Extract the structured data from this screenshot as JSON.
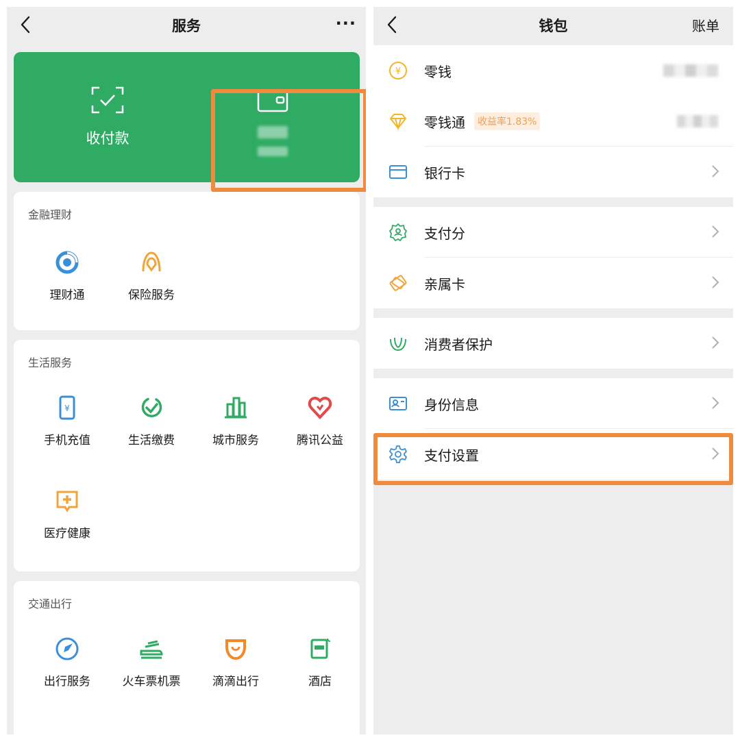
{
  "left": {
    "nav": {
      "title": "服务",
      "more": "···"
    },
    "card": {
      "pay_label": "收付款",
      "wallet_label": ""
    },
    "sections": [
      {
        "title": "金融理财",
        "items": [
          "理财通",
          "保险服务"
        ]
      },
      {
        "title": "生活服务",
        "items": [
          "手机充值",
          "生活缴费",
          "城市服务",
          "腾讯公益",
          "医疗健康"
        ]
      },
      {
        "title": "交通出行",
        "items": [
          "出行服务",
          "火车票机票",
          "滴滴出行",
          "酒店"
        ]
      }
    ]
  },
  "right": {
    "nav": {
      "title": "钱包",
      "bill": "账单"
    },
    "rows": {
      "change": "零钱",
      "licaitong": "零钱通",
      "yield_badge": "收益率1.83%",
      "bank_card": "银行卡",
      "pay_score": "支付分",
      "family_card": "亲属卡",
      "consumer_protection": "消费者保护",
      "identity": "身份信息",
      "pay_settings": "支付设置"
    }
  },
  "colors": {
    "wechat_green": "#2fab64",
    "highlight_orange": "#f08a3c",
    "icon_blue": "#3b8fd6",
    "icon_orange": "#f2a33a"
  }
}
